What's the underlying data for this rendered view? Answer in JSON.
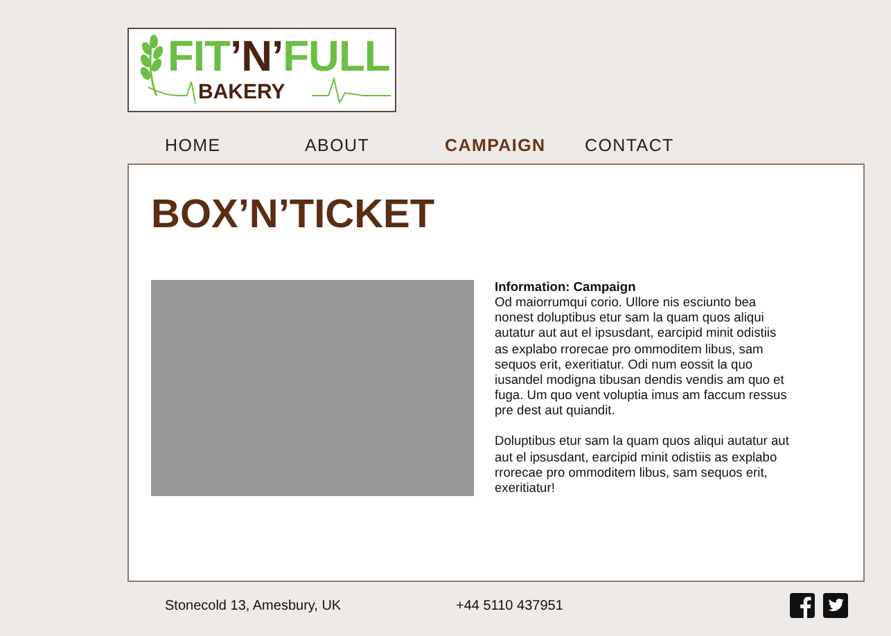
{
  "logo": {
    "segments": [
      {
        "text": "FIT",
        "kind": "main"
      },
      {
        "text": "’N’",
        "kind": "accent"
      },
      {
        "text": "FULL",
        "kind": "main"
      }
    ],
    "tagline": "BAKERY"
  },
  "nav": [
    {
      "label": "HOME",
      "selected": false
    },
    {
      "label": "ABOUT",
      "selected": false
    },
    {
      "label": "CAMPAIGN",
      "selected": true
    },
    {
      "label": "CONTACT",
      "selected": false
    }
  ],
  "page_title": "BOX’N’TICKET",
  "info": {
    "heading": "Information: Campaign",
    "paragraphs": [
      "Od maiorrumqui corio. Ullore nis esciunto bea nonest doluptibus etur sam la quam quos aliqui autatur aut aut el ipsusdant, earcipid minit odistiis as explabo rrorecae pro ommoditem libus, sam sequos erit, exeritiatur. Odi num eossit la quo iusandel modigna tibusan dendis vendis am quo et fuga. Um quo vent voluptia imus am faccum ressus pre dest aut quiandit.",
      "Doluptibus etur sam la quam quos aliqui autatur aut aut el ipsusdant, earcipid minit odistiis as explabo rrorecae pro ommoditem libus, sam sequos erit, exeritiatur!"
    ]
  },
  "footer": {
    "address": "Stonecold 13, Amesbury, UK",
    "phone": "+44 5110 437951",
    "social": [
      {
        "kind": "facebook"
      },
      {
        "kind": "twitter"
      }
    ]
  }
}
